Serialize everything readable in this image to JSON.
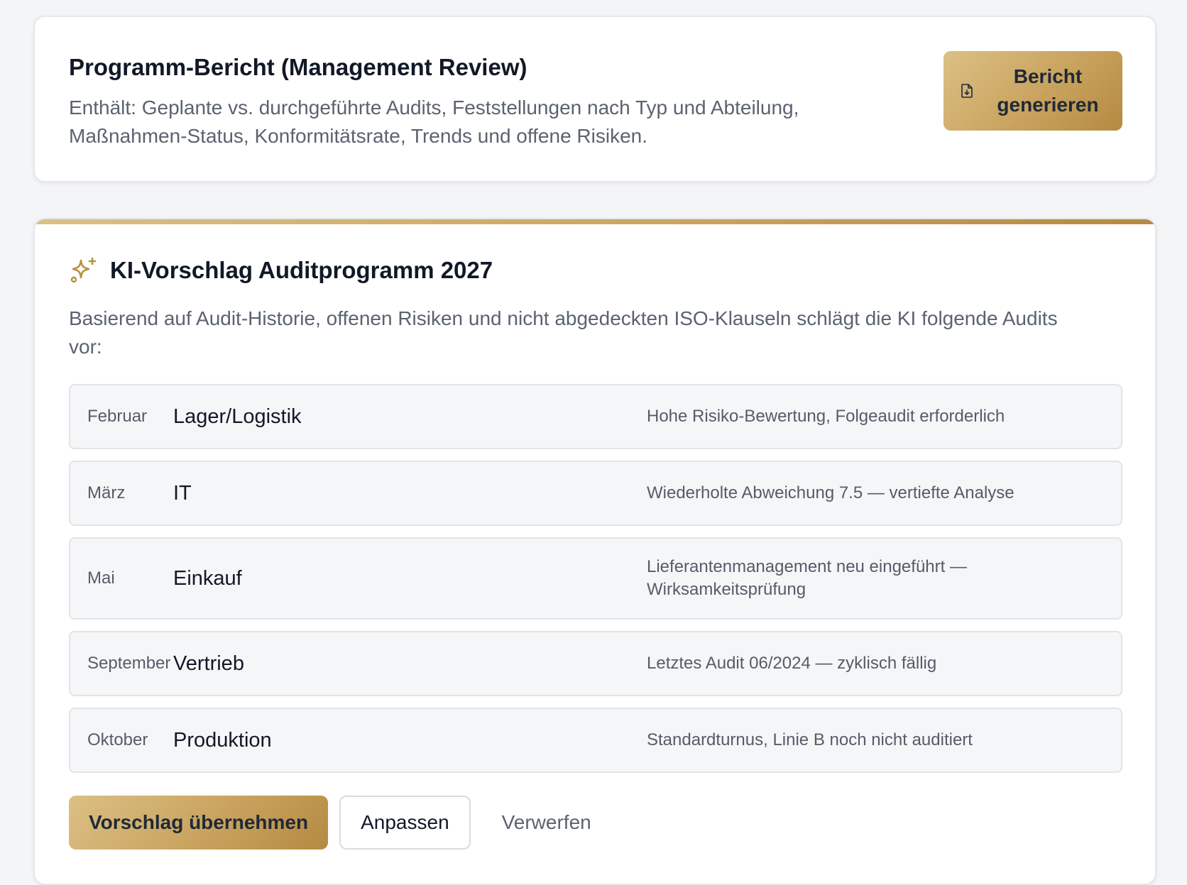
{
  "report": {
    "title": "Programm-Bericht (Management Review)",
    "description": "Enthält: Geplante vs. durchgeführte Audits, Feststellungen nach Typ und Abteilung, Maßnahmen-Status, Konformitätsrate, Trends und offene Risiken.",
    "button_label": "Bericht generieren",
    "button_icon": "file-download-icon"
  },
  "ai_proposal": {
    "title": "KI-Vorschlag Auditprogramm 2027",
    "icon": "sparkles-icon",
    "description": "Basierend auf Audit-Historie, offenen Risiken und nicht abgedeckten ISO-Klauseln schlägt die KI folgende Audits vor:",
    "items": [
      {
        "month": "Februar",
        "department": "Lager/Logistik",
        "reason": "Hohe Risiko-Bewertung, Folgeaudit erforderlich"
      },
      {
        "month": "März",
        "department": "IT",
        "reason": "Wiederholte Abweichung 7.5 — vertiefte Analyse"
      },
      {
        "month": "Mai",
        "department": "Einkauf",
        "reason": "Lieferantenmanagement neu eingeführt — Wirksamkeitsprüfung"
      },
      {
        "month": "September",
        "department": "Vertrieb",
        "reason": "Letztes Audit 06/2024 — zyklisch fällig"
      },
      {
        "month": "Oktober",
        "department": "Produktion",
        "reason": "Standardturnus, Linie B noch nicht auditiert"
      }
    ],
    "actions": {
      "accept_label": "Vorschlag übernehmen",
      "adjust_label": "Anpassen",
      "discard_label": "Verwerfen"
    }
  },
  "colors": {
    "accent_gold_light": "#dcc085",
    "accent_gold_dark": "#b58a42",
    "background": "#f4f5f7",
    "card": "#ffffff"
  }
}
